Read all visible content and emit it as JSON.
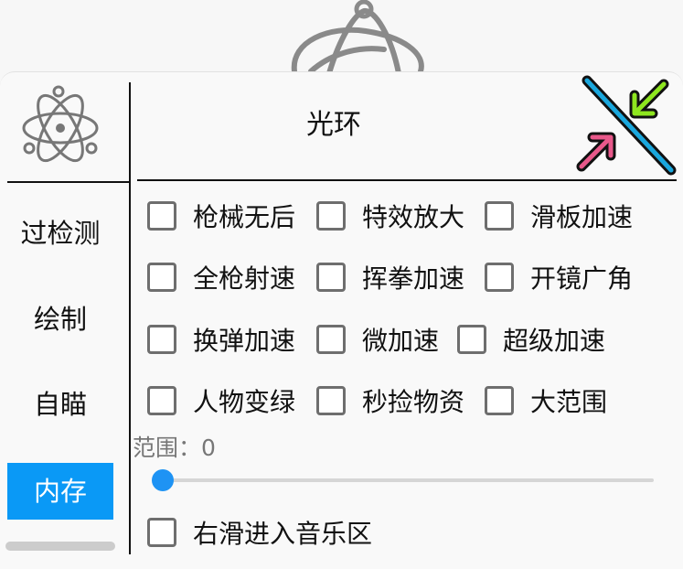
{
  "header": {
    "title": "光环"
  },
  "sidebar": {
    "items": [
      {
        "label": "过检测"
      },
      {
        "label": "绘制"
      },
      {
        "label": "自瞄"
      },
      {
        "label": "内存",
        "active": true
      }
    ]
  },
  "options": [
    {
      "label": "枪械无后",
      "checked": false
    },
    {
      "label": "特效放大",
      "checked": false
    },
    {
      "label": "滑板加速",
      "checked": false
    },
    {
      "label": "全枪射速",
      "checked": false
    },
    {
      "label": "挥拳加速",
      "checked": false
    },
    {
      "label": "开镜广角",
      "checked": false
    },
    {
      "label": "换弹加速",
      "checked": false
    },
    {
      "label": "微加速",
      "checked": false
    },
    {
      "label": "超级加速",
      "checked": false
    },
    {
      "label": "人物变绿",
      "checked": false
    },
    {
      "label": "秒捡物资",
      "checked": false
    },
    {
      "label": "大范围",
      "checked": false
    }
  ],
  "range": {
    "label": "范围：",
    "value": "0",
    "fraction": 0
  },
  "music": {
    "label": "右滑进入音乐区",
    "checked": false
  },
  "icons": {
    "logo": "atom-logo-icon",
    "collapse": "collapse-arrows-icon"
  },
  "colors": {
    "accent": "#0a99f6",
    "slider": "#1e93f4",
    "arrow_green": "#8ee61f",
    "arrow_pink": "#e8588a",
    "slash_blue": "#1aa7dd"
  }
}
